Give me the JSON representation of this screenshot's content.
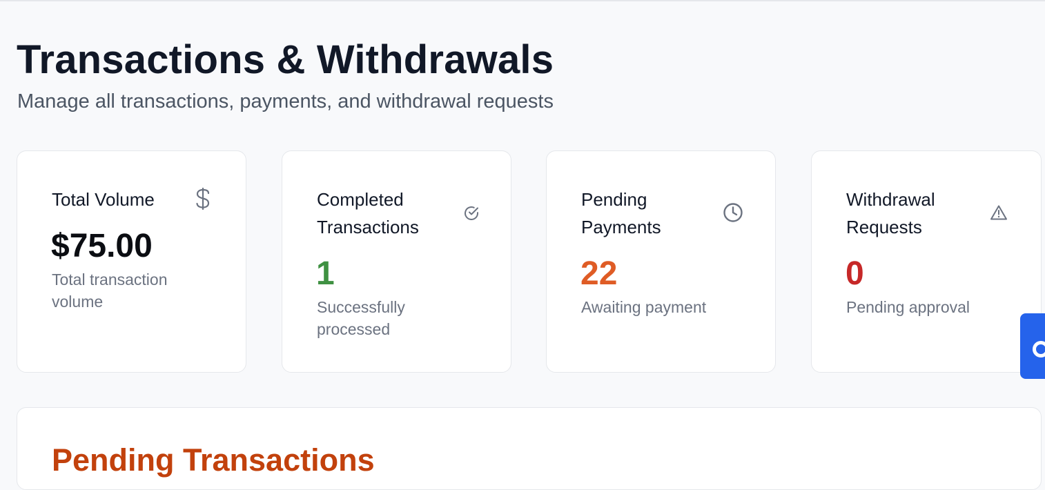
{
  "header": {
    "title": "Transactions & Withdrawals",
    "subtitle": "Manage all transactions, payments, and withdrawal requests"
  },
  "stats": [
    {
      "title": "Total Volume",
      "value": "$75.00",
      "caption": "Total transaction volume",
      "icon": "dollar-icon"
    },
    {
      "title": "Completed Transactions",
      "value": "1",
      "caption": "Successfully processed",
      "icon": "check-circle-icon",
      "color": "#3f9142"
    },
    {
      "title": "Pending Payments",
      "value": "22",
      "caption": "Awaiting payment",
      "icon": "clock-icon",
      "color": "#df5c25"
    },
    {
      "title": "Withdrawal Requests",
      "value": "0",
      "caption": "Pending approval",
      "icon": "alert-triangle-icon",
      "color": "#c62828"
    }
  ],
  "pending_section": {
    "title": "Pending Transactions",
    "color": "#c2410c"
  },
  "side_widget": {
    "icon": "chat-icon",
    "color": "#2563eb"
  }
}
